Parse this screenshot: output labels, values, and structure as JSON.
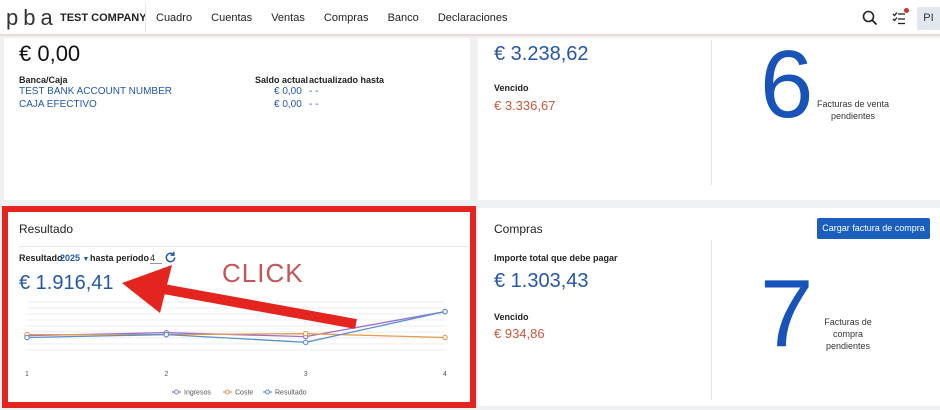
{
  "topbar": {
    "logo": "pba",
    "company": "TEST COMPANY",
    "nav": [
      "Cuadro",
      "Cuentas",
      "Ventas",
      "Compras",
      "Banco",
      "Declaraciones"
    ],
    "avatar": "PI",
    "icons": [
      "search-icon",
      "tasks-icon"
    ]
  },
  "bank": {
    "total": "€ 0,00",
    "col_account": "Banca/Caja",
    "col_balance": "Saldo actual",
    "col_updated": "actualizado hasta",
    "rows": [
      {
        "name": "TEST BANK ACCOUNT NUMBER",
        "balance": "€ 0,00",
        "updated": "- -"
      },
      {
        "name": "CAJA EFECTIVO",
        "balance": "€ 0,00",
        "updated": "- -"
      }
    ]
  },
  "sales": {
    "total": "€ 3.238,62",
    "due_label": "Vencido",
    "due": "€ 3.336,67",
    "pending_count": "6",
    "pending_label_1": "Facturas de venta",
    "pending_label_2": "pendientes"
  },
  "result": {
    "title": "Resultado",
    "filter_label": "Resultado",
    "year": "2025",
    "period_label": "hasta período",
    "period": "4",
    "amount": "€ 1.916,41"
  },
  "annotation": {
    "text": "CLICK",
    "color": "#e3241f"
  },
  "purchases": {
    "title": "Compras",
    "button": "Cargar factura de compra",
    "total_label": "Importe total que debe pagar",
    "total": "€ 1.303,43",
    "due_label": "Vencido",
    "due": "€ 934,86",
    "pending_count": "7",
    "pending_label_1": "Facturas de",
    "pending_label_2": "compra",
    "pending_label_3": "pendientes"
  },
  "chart_data": {
    "type": "line",
    "x": [
      1,
      2,
      3,
      4
    ],
    "series": [
      {
        "name": "Ingresos",
        "color": "#9b6fd0",
        "values": [
          0.5,
          0.8,
          0.4,
          3.0
        ]
      },
      {
        "name": "Coste",
        "color": "#e49a4a",
        "values": [
          0.6,
          0.6,
          0.7,
          0.3
        ]
      },
      {
        "name": "Resultado",
        "color": "#5a8fd0",
        "values": [
          0.3,
          0.6,
          -0.2,
          3.0
        ]
      }
    ],
    "ylim": [
      -1,
      4
    ],
    "grid": true,
    "legend": "bottom"
  },
  "colors": {
    "accent": "#2457a7",
    "danger": "#c55a3c",
    "highlight": "#e3241f"
  }
}
